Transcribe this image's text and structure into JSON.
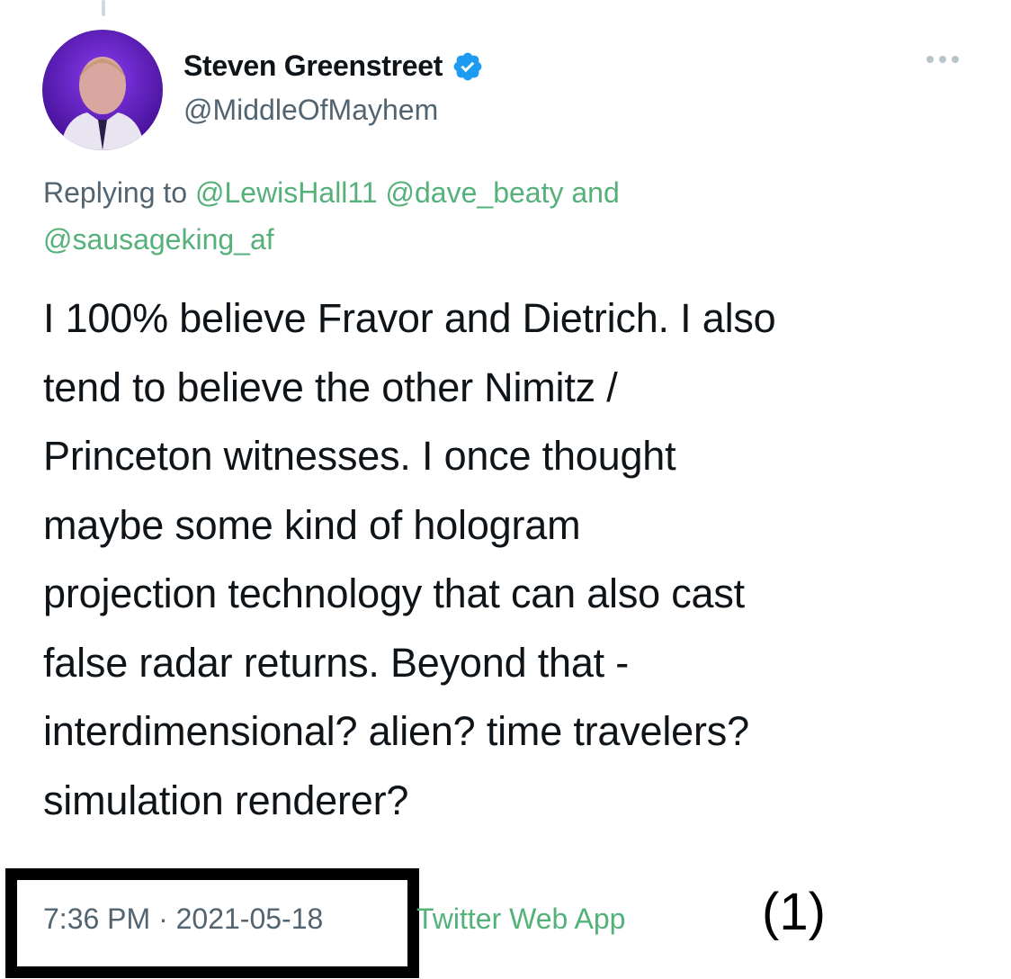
{
  "author": {
    "display_name": "Steven Greenstreet",
    "handle": "@MiddleOfMayhem"
  },
  "reply_context": {
    "prefix": "Replying to ",
    "mentions": [
      "@LewisHall11",
      "@dave_beaty",
      "@sausageking_af"
    ],
    "conjunction": " and"
  },
  "tweet": {
    "text": "I 100% believe Fravor and Dietrich. I also\ntend to believe the other Nimitz /\nPrinceton witnesses. I once thought\nmaybe some kind of hologram\nprojection technology that can also cast\nfalse radar returns.  Beyond that -\ninterdimensional? alien? time travelers?\nsimulation renderer?",
    "timestamp": "7:36 PM · 2021-05-18",
    "source": "Twitter Web App"
  },
  "annotation": "(1)",
  "icons": {
    "verified": "verified-badge-icon",
    "more": "more-options-icon"
  },
  "colors": {
    "link": "#55b17a",
    "secondary_text": "#536471",
    "verified": "#1d9bf0",
    "highlight_box": "#000000"
  }
}
